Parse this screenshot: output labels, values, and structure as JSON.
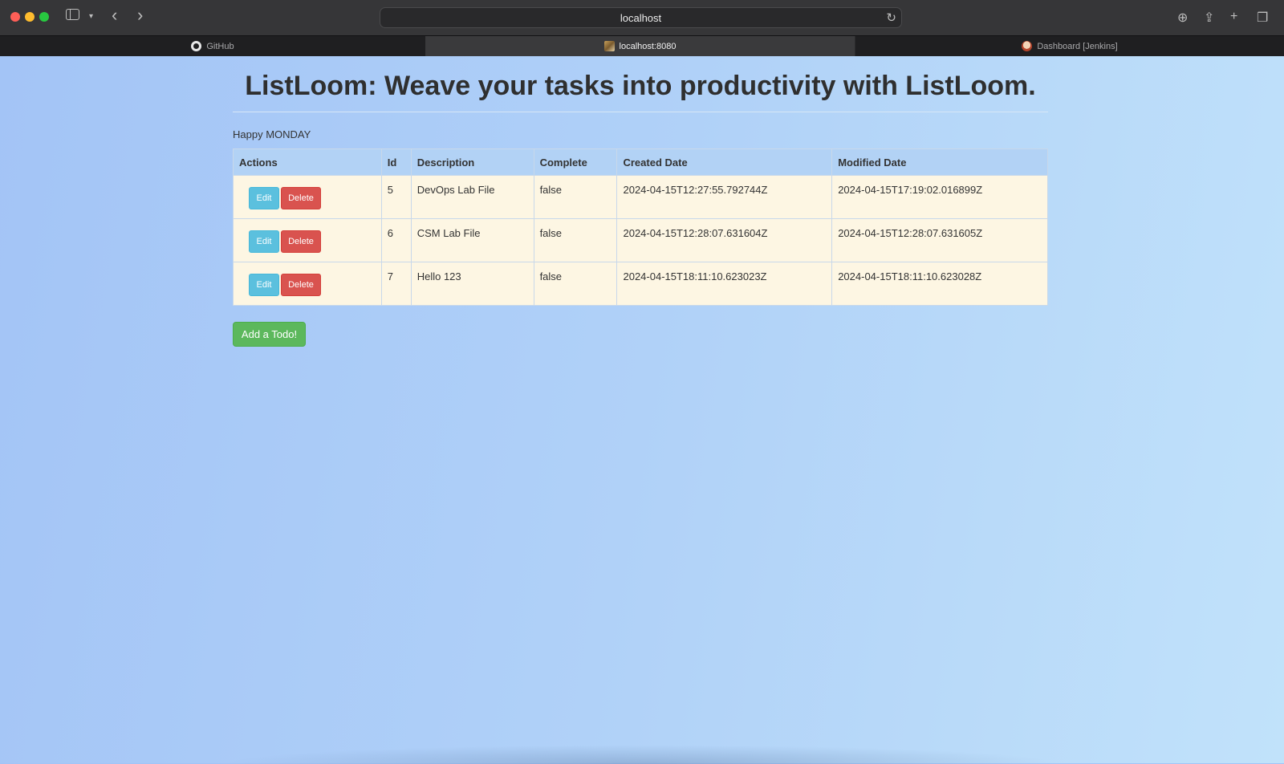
{
  "browser": {
    "address": "localhost",
    "tabs": [
      {
        "label": "GitHub",
        "icon": "github-icon"
      },
      {
        "label": "localhost:8080",
        "icon": "site-favicon"
      },
      {
        "label": "Dashboard [Jenkins]",
        "icon": "jenkins-icon"
      }
    ]
  },
  "page": {
    "title": "ListLoom: Weave your tasks into productivity with ListLoom.",
    "greeting": "Happy MONDAY",
    "table": {
      "headers": [
        "Actions",
        "Id",
        "Description",
        "Complete",
        "Created Date",
        "Modified Date"
      ],
      "rows": [
        {
          "id": "5",
          "description": "DevOps Lab File",
          "complete": "false",
          "created": "2024-04-15T12:27:55.792744Z",
          "modified": "2024-04-15T17:19:02.016899Z"
        },
        {
          "id": "6",
          "description": "CSM Lab File",
          "complete": "false",
          "created": "2024-04-15T12:28:07.631604Z",
          "modified": "2024-04-15T12:28:07.631605Z"
        },
        {
          "id": "7",
          "description": "Hello 123",
          "complete": "false",
          "created": "2024-04-15T18:11:10.623023Z",
          "modified": "2024-04-15T18:11:10.623028Z"
        }
      ],
      "edit_label": "Edit",
      "delete_label": "Delete"
    },
    "add_label": "Add a Todo!"
  },
  "colors": {
    "edit_button": "#5bc0de",
    "delete_button": "#d9534f",
    "add_button": "#5cb85c",
    "row_background": "#fdf6e3"
  }
}
